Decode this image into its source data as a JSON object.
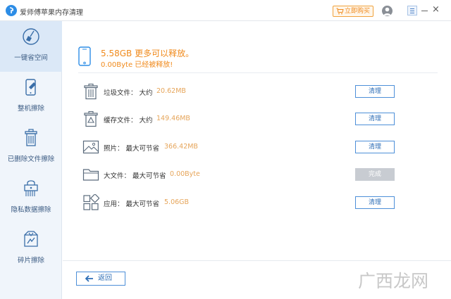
{
  "app": {
    "title": "爱师傅苹果内存清理",
    "buy_label": "立即购买"
  },
  "sidebar": {
    "items": [
      {
        "label": "一键省空间",
        "icon": "broom-icon",
        "active": true
      },
      {
        "label": "整机擦除",
        "icon": "phone-erase-icon",
        "active": false
      },
      {
        "label": "已删除文件擦除",
        "icon": "trash-shred-icon",
        "active": false
      },
      {
        "label": "隐私数据擦除",
        "icon": "privacy-lock-icon",
        "active": false
      },
      {
        "label": "碎片擦除",
        "icon": "fragment-erase-icon",
        "active": false
      }
    ]
  },
  "summary": {
    "size": "5.58GB  更多可以释放。",
    "freed": "0.00Byte  已经被释放!"
  },
  "rows": [
    {
      "label": "垃圾文件：  大约",
      "size": "20.62MB",
      "button": "清理",
      "icon": "trash-icon",
      "done": false
    },
    {
      "label": "缓存文件：  大约",
      "size": "149.46MB",
      "button": "清理",
      "icon": "cache-trash-icon",
      "done": false
    },
    {
      "label": "照片：  最大可节省",
      "size": "366.42MB",
      "button": "清理",
      "icon": "photo-icon",
      "done": false
    },
    {
      "label": "大文件：  最大可节省",
      "size": "0.00Byte",
      "button": "完成",
      "icon": "folder-icon",
      "done": true
    },
    {
      "label": "应用：  最大可节省",
      "size": "5.06GB",
      "button": "清理",
      "icon": "apps-icon",
      "done": false
    }
  ],
  "footer": {
    "back_label": "返回"
  },
  "watermark": "广西龙网",
  "colors": {
    "accent": "#2d8de6",
    "highlight": "#f08a1c",
    "sidebar_bg": "#f0f5fb"
  }
}
